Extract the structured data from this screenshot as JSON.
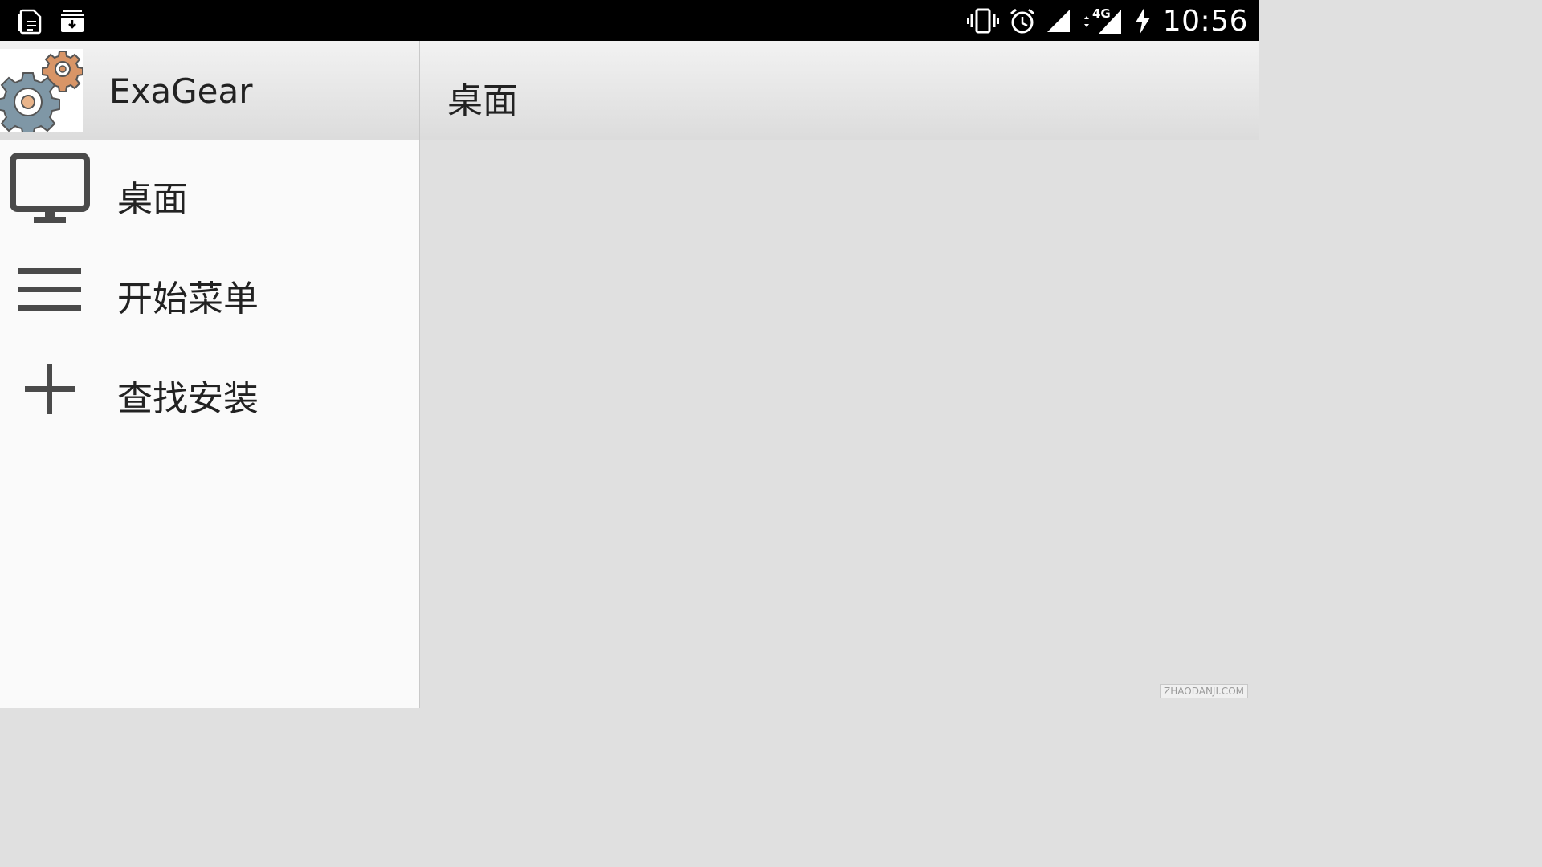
{
  "status_bar": {
    "time": "10:56",
    "network": "4G",
    "left_icons": [
      "document-icon",
      "download-stack-icon"
    ],
    "right_icons": [
      "vibrate-icon",
      "alarm-icon",
      "signal-icon",
      "signal-4g-icon",
      "charging-icon"
    ]
  },
  "drawer": {
    "app_name": "ExaGear",
    "items": [
      {
        "label": "桌面",
        "icon": "monitor-icon"
      },
      {
        "label": "开始菜单",
        "icon": "menu-lines-icon"
      },
      {
        "label": "查找安装",
        "icon": "plus-icon"
      }
    ]
  },
  "content": {
    "title": "桌面"
  },
  "watermark": "ZHAODANJI.COM",
  "colors": {
    "status_bar_bg": "#000000",
    "drawer_bg": "#fafafa",
    "content_bg": "#e0e0e0",
    "icon_gray": "#4a4a4a",
    "gear_orange": "#d89567",
    "gear_blue": "#7f97a6"
  }
}
